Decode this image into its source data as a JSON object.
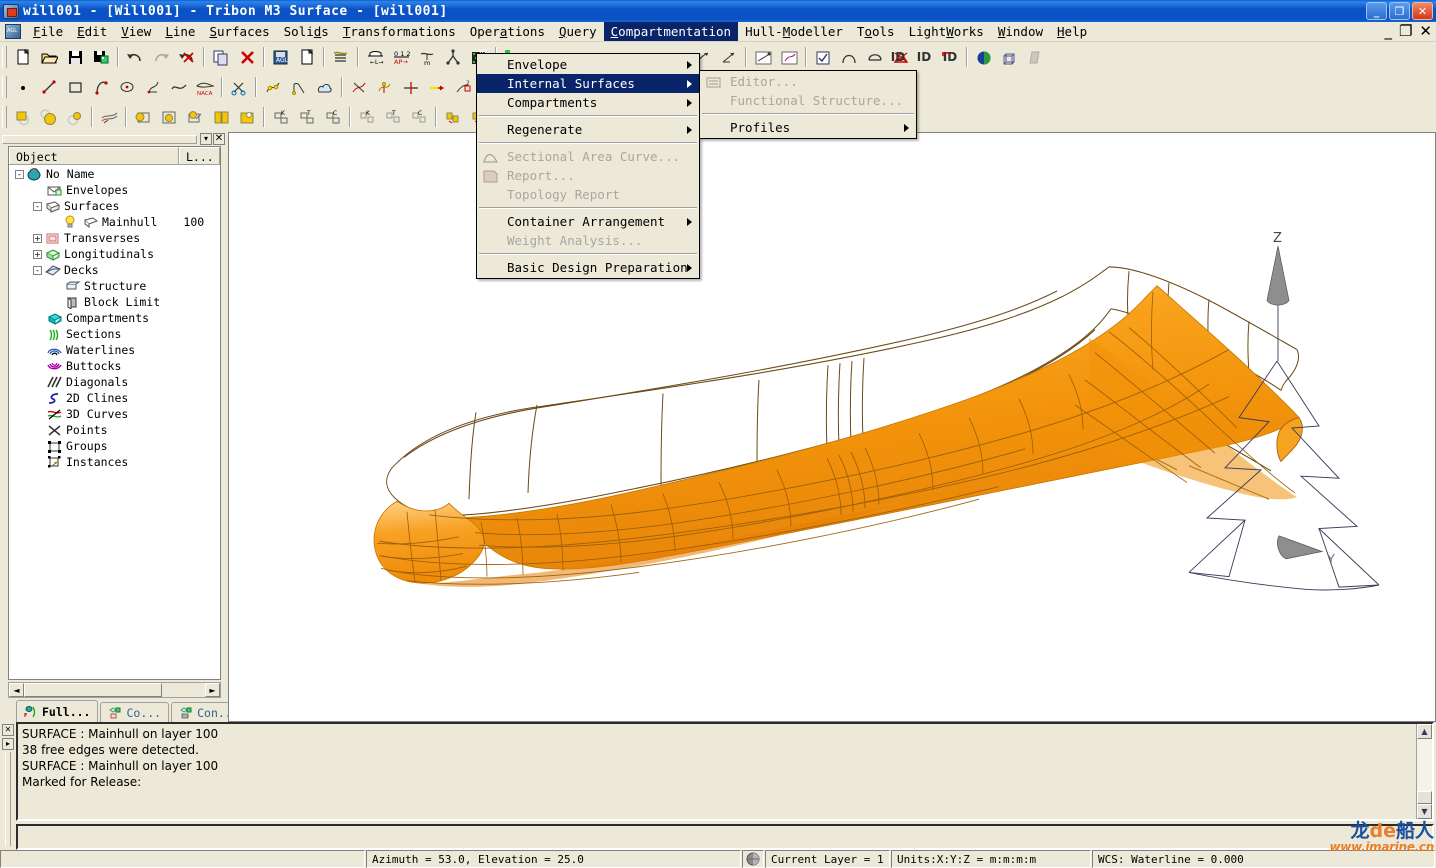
{
  "window": {
    "title": "will001 - [Will001] - Tribon M3 Surface - [will001]",
    "minimize": "_",
    "restore": "❐",
    "close": "✕"
  },
  "mdi": {
    "minimize": "_",
    "restore": "❐",
    "close": "✕"
  },
  "menubar": {
    "items": [
      {
        "label": "File",
        "mnemonic": "F"
      },
      {
        "label": "Edit",
        "mnemonic": "E"
      },
      {
        "label": "View",
        "mnemonic": "V"
      },
      {
        "label": "Line",
        "mnemonic": "L"
      },
      {
        "label": "Surfaces",
        "mnemonic": "S"
      },
      {
        "label": "Solids",
        "mnemonic": "d"
      },
      {
        "label": "Transformations",
        "mnemonic": "T"
      },
      {
        "label": "Operations",
        "mnemonic": "a"
      },
      {
        "label": "Query",
        "mnemonic": "Q"
      },
      {
        "label": "Compartmentation",
        "mnemonic": "C",
        "active": true
      },
      {
        "label": "Hull-Modeller",
        "mnemonic": "M"
      },
      {
        "label": "Tools",
        "mnemonic": "o"
      },
      {
        "label": "LightWorks",
        "mnemonic": "W"
      },
      {
        "label": "Window",
        "mnemonic": "W"
      },
      {
        "label": "Help",
        "mnemonic": "H"
      }
    ]
  },
  "compartmentation_menu": {
    "items": [
      {
        "label": "Envelope",
        "submenu": true,
        "disabled": false,
        "selected": false
      },
      {
        "label": "Internal Surfaces",
        "submenu": true,
        "disabled": false,
        "selected": true
      },
      {
        "label": "Compartments",
        "submenu": true,
        "disabled": false,
        "selected": false
      },
      {
        "separator": true
      },
      {
        "label": "Regenerate",
        "submenu": true,
        "disabled": false,
        "selected": false
      },
      {
        "separator": true
      },
      {
        "label": "Sectional Area Curve...",
        "submenu": false,
        "disabled": true,
        "icon": "area-curve-icon"
      },
      {
        "label": "Report...",
        "submenu": false,
        "disabled": true,
        "icon": "report-icon"
      },
      {
        "label": "Topology Report",
        "submenu": false,
        "disabled": true
      },
      {
        "separator": true
      },
      {
        "label": "Container Arrangement",
        "submenu": true,
        "disabled": false
      },
      {
        "label": "Weight Analysis...",
        "submenu": false,
        "disabled": true
      },
      {
        "separator": true
      },
      {
        "label": "Basic Design Preparation",
        "submenu": true,
        "disabled": false
      }
    ]
  },
  "internal_surfaces_submenu": {
    "items": [
      {
        "label": "Editor...",
        "submenu": false,
        "disabled": true,
        "icon": "editor-icon"
      },
      {
        "label": "Functional Structure...",
        "submenu": false,
        "disabled": true
      },
      {
        "separator": true
      },
      {
        "label": "Profiles",
        "submenu": true,
        "disabled": false
      }
    ]
  },
  "toolbars": {
    "row1": [
      {
        "name": "new-file-icon",
        "glyph": "new"
      },
      {
        "name": "open-file-icon",
        "glyph": "open"
      },
      {
        "name": "save-icon",
        "glyph": "save"
      },
      {
        "name": "save-model-icon",
        "glyph": "savemodel"
      },
      {
        "sep": true
      },
      {
        "name": "undo-icon",
        "glyph": "undo"
      },
      {
        "name": "redo-icon",
        "glyph": "redo",
        "disabled": true
      },
      {
        "name": "undo-all-icon",
        "glyph": "undoall"
      },
      {
        "sep": true
      },
      {
        "name": "copy-icon",
        "glyph": "copy"
      },
      {
        "name": "delete-icon",
        "glyph": "delete"
      },
      {
        "sep": true
      },
      {
        "name": "agl-icon",
        "glyph": "agl"
      },
      {
        "name": "blank-page-icon",
        "glyph": "page"
      },
      {
        "sep": true
      },
      {
        "name": "layers-icon",
        "glyph": "layers"
      },
      {
        "sep": true
      },
      {
        "name": "length-icon",
        "glyph": "length"
      },
      {
        "name": "frames-icon",
        "glyph": "frames"
      },
      {
        "name": "meters-icon",
        "glyph": "meters"
      },
      {
        "name": "axes-icon",
        "glyph": "axes"
      },
      {
        "name": "wcs-icon",
        "glyph": "wcs"
      },
      {
        "sep": true
      },
      {
        "name": "network-icon",
        "glyph": "network"
      }
    ],
    "row2": [
      {
        "name": "point-icon",
        "glyph": "point"
      },
      {
        "name": "line-icon",
        "glyph": "line"
      },
      {
        "name": "rectangle-icon",
        "glyph": "rect"
      },
      {
        "name": "arc-icon",
        "glyph": "arc"
      },
      {
        "name": "circle-icon",
        "glyph": "circle"
      },
      {
        "name": "spline-icon",
        "glyph": "spline"
      },
      {
        "name": "curve-icon",
        "glyph": "curve"
      },
      {
        "name": "naca-icon",
        "glyph": "naca"
      },
      {
        "sep": true
      },
      {
        "name": "trim-icon",
        "glyph": "scissors"
      },
      {
        "sep": true
      },
      {
        "name": "modify-curve-icon",
        "glyph": "modcurve"
      },
      {
        "name": "corner-icon",
        "glyph": "corner"
      },
      {
        "name": "surface-cloud-icon",
        "glyph": "cloud"
      },
      {
        "sep": true
      },
      {
        "name": "intersect-icon",
        "glyph": "xpoint"
      },
      {
        "name": "project-icon",
        "glyph": "project"
      },
      {
        "name": "split-icon",
        "glyph": "split"
      },
      {
        "name": "extend-icon",
        "glyph": "extend"
      },
      {
        "name": "offset2-icon",
        "glyph": "offset2"
      },
      {
        "name": "fair-icon",
        "glyph": "fair",
        "disabled": true
      },
      {
        "name": "relimit-icon",
        "glyph": "relimit"
      }
    ],
    "row3": [
      {
        "name": "surface-a-icon",
        "glyph": "surfa"
      },
      {
        "name": "surface-b-icon",
        "glyph": "surfb"
      },
      {
        "name": "surface-c-icon",
        "glyph": "surfc"
      },
      {
        "sep": true
      },
      {
        "name": "loft-icon",
        "glyph": "loft"
      },
      {
        "sep": true
      },
      {
        "name": "surf-op1-icon",
        "glyph": "sop1"
      },
      {
        "name": "surf-op2-icon",
        "glyph": "sop2"
      },
      {
        "name": "surf-op3-icon",
        "glyph": "sop3"
      },
      {
        "name": "surf-op4-icon",
        "glyph": "sop4"
      },
      {
        "name": "surf-op5-icon",
        "glyph": "sop5"
      },
      {
        "sep": true
      },
      {
        "name": "knuckle-k-icon",
        "glyph": "kk"
      },
      {
        "name": "knuckle-t-icon",
        "glyph": "kt"
      },
      {
        "name": "knuckle-c-icon",
        "glyph": "kc"
      },
      {
        "sep": true
      },
      {
        "name": "patch-k-icon",
        "glyph": "pk"
      },
      {
        "name": "patch-t-icon",
        "glyph": "pt"
      },
      {
        "name": "patch-c-icon",
        "glyph": "pc"
      },
      {
        "sep": true
      },
      {
        "name": "fold-a-icon",
        "glyph": "fa"
      },
      {
        "name": "fold-b-icon",
        "glyph": "fb"
      },
      {
        "name": "fold-c-icon",
        "glyph": "fc"
      }
    ],
    "row1_right": [
      {
        "name": "dim-icon",
        "glyph": "dim"
      },
      {
        "name": "id-icon",
        "glyph": "id"
      },
      {
        "name": "id-arrow-icon",
        "glyph": "idarrow"
      },
      {
        "sep": true
      },
      {
        "name": "render-icon",
        "glyph": "render"
      },
      {
        "name": "wireframe-icon",
        "glyph": "wire"
      },
      {
        "name": "shade-icon",
        "glyph": "shade",
        "disabled": true
      }
    ],
    "row1_mid": [
      {
        "name": "curve-tool-1-icon",
        "glyph": "ct1"
      },
      {
        "name": "curve-tool-2-icon",
        "glyph": "ct2"
      },
      {
        "sep": true
      },
      {
        "name": "curve-tool-3-icon",
        "glyph": "ct3"
      },
      {
        "name": "curve-tool-4-icon",
        "glyph": "ct4"
      },
      {
        "sep": true
      },
      {
        "name": "check-box-icon",
        "glyph": "cb1"
      },
      {
        "name": "arch-icon",
        "glyph": "arch"
      },
      {
        "name": "dome-icon",
        "glyph": "dome"
      },
      {
        "name": "fan-icon",
        "glyph": "fan"
      }
    ]
  },
  "object_tree": {
    "columns": [
      "Object",
      "L..."
    ],
    "nodes": [
      {
        "label": "No Name",
        "indent": 0,
        "toggle": "-",
        "icon": "model-icon"
      },
      {
        "label": "Envelopes",
        "indent": 1,
        "toggle": "",
        "icon": "envelopes-icon"
      },
      {
        "label": "Surfaces",
        "indent": 1,
        "toggle": "-",
        "icon": "surfaces-icon"
      },
      {
        "label": "Mainhull",
        "indent": 2,
        "toggle": "",
        "icon": "surface-item-icon",
        "bulb": true,
        "layer": "100"
      },
      {
        "label": "Transverses",
        "indent": 1,
        "toggle": "+",
        "icon": "transverses-icon"
      },
      {
        "label": "Longitudinals",
        "indent": 1,
        "toggle": "+",
        "icon": "longitudinals-icon"
      },
      {
        "label": "Decks",
        "indent": 1,
        "toggle": "-",
        "icon": "decks-icon"
      },
      {
        "label": "Structure",
        "indent": 2,
        "toggle": "",
        "icon": "structure-icon"
      },
      {
        "label": "Block Limit",
        "indent": 2,
        "toggle": "",
        "icon": "block-limit-icon"
      },
      {
        "label": "Compartments",
        "indent": 1,
        "toggle": "",
        "icon": "compartments-icon"
      },
      {
        "label": "Sections",
        "indent": 1,
        "toggle": "",
        "icon": "sections-icon"
      },
      {
        "label": "Waterlines",
        "indent": 1,
        "toggle": "",
        "icon": "waterlines-icon"
      },
      {
        "label": "Buttocks",
        "indent": 1,
        "toggle": "",
        "icon": "buttocks-icon"
      },
      {
        "label": "Diagonals",
        "indent": 1,
        "toggle": "",
        "icon": "diagonals-icon"
      },
      {
        "label": "2D Clines",
        "indent": 1,
        "toggle": "",
        "icon": "clines-2d-icon"
      },
      {
        "label": "3D Curves",
        "indent": 1,
        "toggle": "",
        "icon": "curves-3d-icon"
      },
      {
        "label": "Points",
        "indent": 1,
        "toggle": "",
        "icon": "points-icon"
      },
      {
        "label": "Groups",
        "indent": 1,
        "toggle": "",
        "icon": "groups-icon"
      },
      {
        "label": "Instances",
        "indent": 1,
        "toggle": "",
        "icon": "instances-icon"
      }
    ]
  },
  "panel_tabs": [
    {
      "label": "Full...",
      "selected": true,
      "icon": "full-tree-icon"
    },
    {
      "label": "Co...",
      "selected": false,
      "icon": "compartment-tree-icon"
    },
    {
      "label": "Con...",
      "selected": false,
      "icon": "container-tree-icon"
    }
  ],
  "messages": {
    "lines": [
      "SURFACE : Mainhull on layer 100",
      "38 free edges were detected.",
      "SURFACE : Mainhull on layer 100",
      "Marked for Release:"
    ],
    "command_value": ""
  },
  "statusbar": {
    "hint": "",
    "azimuth_elevation": "Azimuth = 53.0,  Elevation = 25.0",
    "layer": "Current Layer = 1",
    "units": "Units:X:Y:Z = m:m:m:m",
    "wcs": "WCS: Waterline = 0.000",
    "globe_icon": "globe-icon"
  },
  "viewport": {
    "axis_labels": {
      "z": "Z",
      "y": "Y"
    },
    "model_name": "Mainhull",
    "hull_color": "#F59A0E",
    "hull_color_light": "#FCC96A",
    "wire_color": "#8a5a10",
    "deck_wire_color": "#6b4a16"
  },
  "watermark": {
    "line1_a": "龙",
    "line1_b": "de",
    "line1_c": "船人",
    "line2": "www.imarine.cn"
  }
}
